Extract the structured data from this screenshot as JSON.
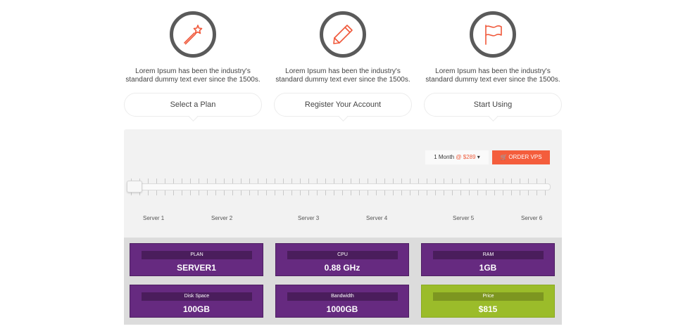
{
  "steps": [
    {
      "icon": "magic-wand-icon",
      "description": "Lorem Ipsum has been the industry's standard dummy text ever since the 1500s.",
      "button": "Select a Plan"
    },
    {
      "icon": "pencil-icon",
      "description": "Lorem Ipsum has been the industry's standard dummy text ever since the 1500s.",
      "button": "Register Your Account"
    },
    {
      "icon": "flag-icon",
      "description": "Lorem Ipsum has been the industry's standard dummy text ever since the 1500s.",
      "button": "Start Using"
    }
  ],
  "billing": {
    "period": "1 Month",
    "at": "@",
    "price": "$289"
  },
  "order_button": "ORDER VPS",
  "slider": {
    "selected_fraction": 0
  },
  "servers": [
    "Server 1",
    "Server 2",
    "Server 3",
    "Server 4",
    "Server 5",
    "Server 6"
  ],
  "specs": {
    "plan": {
      "label": "PLAN",
      "value": "SERVER1"
    },
    "cpu": {
      "label": "CPU",
      "value": "0.88 GHz"
    },
    "ram": {
      "label": "RAM",
      "value": "1GB"
    },
    "disk": {
      "label": "Disk Space",
      "value": "100GB"
    },
    "bandwidth": {
      "label": "Bandwidth",
      "value": "1000GB"
    },
    "price": {
      "label": "Price",
      "value": "$815"
    }
  },
  "colors": {
    "accent": "#f45d3c",
    "card": "#662a80",
    "price_card": "#9bbc2a"
  }
}
